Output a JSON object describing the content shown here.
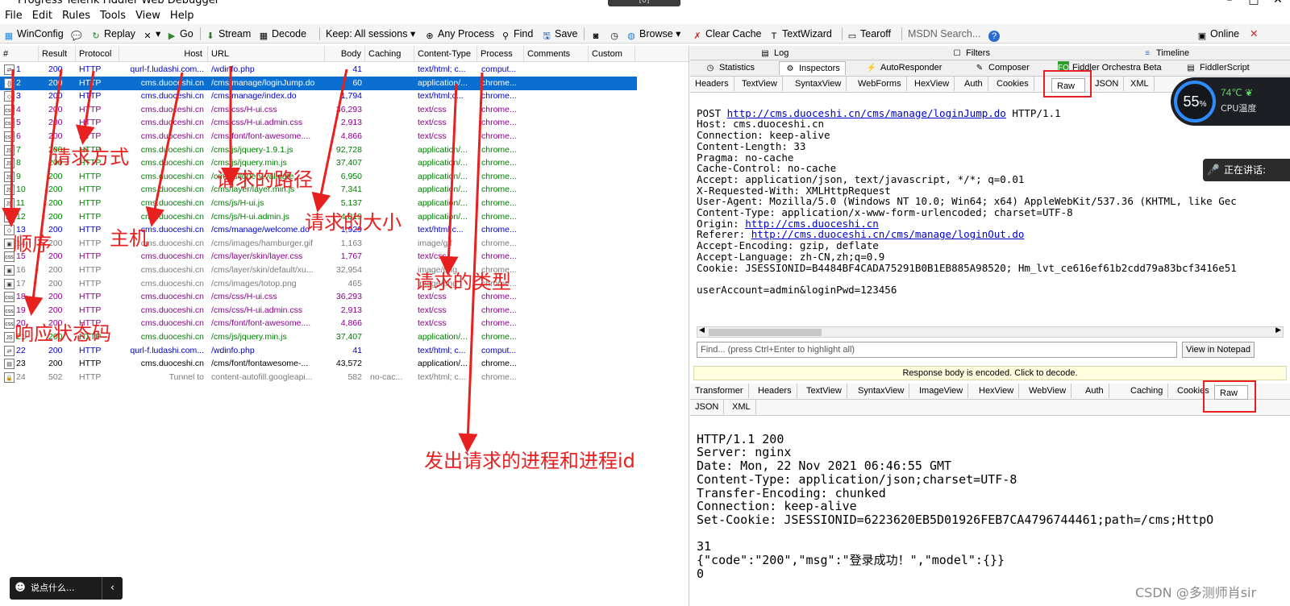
{
  "window": {
    "title": "Progress Telerik Fiddler Web Debugger",
    "controls": [
      "–",
      "□",
      "✕"
    ],
    "notice": "[0]"
  },
  "menu": [
    "File",
    "Edit",
    "Rules",
    "Tools",
    "View",
    "Help"
  ],
  "toolbar": {
    "winconfig": "WinConfig",
    "replay": "Replay",
    "remove_arrow": "▾",
    "go": "Go",
    "stream": "Stream",
    "decode": "Decode",
    "keep": "Keep: All sessions",
    "any_process": "Any Process",
    "find": "Find",
    "save": "Save",
    "browse": "Browse",
    "clear_cache": "Clear Cache",
    "textwizard": "TextWizard",
    "tearoff": "Tearoff",
    "msdn_search": "MSDN Search...",
    "online": "Online",
    "close_x": "✕"
  },
  "sessions": {
    "columns": [
      "#",
      "Result",
      "Protocol",
      "Host",
      "URL",
      "Body",
      "Caching",
      "Content-Type",
      "Process",
      "Comments",
      "Custom"
    ],
    "rows": [
      {
        "num": "1",
        "result": "200",
        "protocol": "HTTP",
        "host": "qurl-f.ludashi.com...",
        "url": "/wdinfo.php",
        "body": "41",
        "caching": "",
        "ctype": "text/html; c...",
        "process": "comput...",
        "icon": "⇄",
        "color": "#0000cc"
      },
      {
        "num": "2",
        "result": "200",
        "protocol": "HTTP",
        "host": "cms.duoceshi.cn",
        "url": "/cms/manage/loginJump.do",
        "body": "60",
        "caching": "",
        "ctype": "application/...",
        "process": "chrome...",
        "icon": "{}",
        "color": "#000000",
        "selected": true
      },
      {
        "num": "3",
        "result": "200",
        "protocol": "HTTP",
        "host": "cms.duoceshi.cn",
        "url": "/cms/manage/index.do",
        "body": "1,794",
        "caching": "",
        "ctype": "text/html;c...",
        "process": "chrome...",
        "icon": "◇",
        "color": "#0000cc"
      },
      {
        "num": "4",
        "result": "200",
        "protocol": "HTTP",
        "host": "cms.duoceshi.cn",
        "url": "/cms/css/H-ui.css",
        "body": "36,293",
        "caching": "",
        "ctype": "text/css",
        "process": "chrome...",
        "icon": "css",
        "color": "#8b008b"
      },
      {
        "num": "5",
        "result": "200",
        "protocol": "HTTP",
        "host": "cms.duoceshi.cn",
        "url": "/cms/css/H-ui.admin.css",
        "body": "2,913",
        "caching": "",
        "ctype": "text/css",
        "process": "chrome...",
        "icon": "css",
        "color": "#8b008b"
      },
      {
        "num": "6",
        "result": "200",
        "protocol": "HTTP",
        "host": "cms.duoceshi.cn",
        "url": "/cms/font/font-awesome....",
        "body": "4,866",
        "caching": "",
        "ctype": "text/css",
        "process": "chrome...",
        "icon": "css",
        "color": "#8b008b"
      },
      {
        "num": "7",
        "result": "200",
        "protocol": "HTTP",
        "host": "cms.duoceshi.cn",
        "url": "/cms/js/jquery-1.9.1.js",
        "body": "92,728",
        "caching": "",
        "ctype": "application/...",
        "process": "chrome...",
        "icon": "JS",
        "color": "#008000"
      },
      {
        "num": "8",
        "result": "200",
        "protocol": "HTTP",
        "host": "cms.duoceshi.cn",
        "url": "/cms/js/jquery.min.js",
        "body": "37,407",
        "caching": "",
        "ctype": "application/...",
        "process": "chrome...",
        "icon": "JS",
        "color": "#008000"
      },
      {
        "num": "9",
        "result": "200",
        "protocol": "HTTP",
        "host": "cms.duoceshi.cn",
        "url": "/cms/js/jquery.validate...",
        "body": "6,950",
        "caching": "",
        "ctype": "application/...",
        "process": "chrome...",
        "icon": "JS",
        "color": "#008000"
      },
      {
        "num": "10",
        "result": "200",
        "protocol": "HTTP",
        "host": "cms.duoceshi.cn",
        "url": "/cms/layer/layer.min.js",
        "body": "7,341",
        "caching": "",
        "ctype": "application/...",
        "process": "chrome...",
        "icon": "JS",
        "color": "#008000"
      },
      {
        "num": "11",
        "result": "200",
        "protocol": "HTTP",
        "host": "cms.duoceshi.cn",
        "url": "/cms/js/H-ui.js",
        "body": "5,137",
        "caching": "",
        "ctype": "application/...",
        "process": "chrome...",
        "icon": "JS",
        "color": "#008000"
      },
      {
        "num": "12",
        "result": "200",
        "protocol": "HTTP",
        "host": "cms.duoceshi.cn",
        "url": "/cms/js/H-ui.admin.js",
        "body": "4,819",
        "caching": "",
        "ctype": "application/...",
        "process": "chrome...",
        "icon": "JS",
        "color": "#008000"
      },
      {
        "num": "13",
        "result": "200",
        "protocol": "HTTP",
        "host": "cms.duoceshi.cn",
        "url": "/cms/manage/welcome.do",
        "body": "1,929",
        "caching": "",
        "ctype": "text/html;c...",
        "process": "chrome...",
        "icon": "◇",
        "color": "#0000cc"
      },
      {
        "num": "14",
        "result": "200",
        "protocol": "HTTP",
        "host": "cms.duoceshi.cn",
        "url": "/cms/images/hamburger.gif",
        "body": "1,163",
        "caching": "",
        "ctype": "image/gif",
        "process": "chrome...",
        "icon": "▣",
        "color": "#7a7a7a"
      },
      {
        "num": "15",
        "result": "200",
        "protocol": "HTTP",
        "host": "cms.duoceshi.cn",
        "url": "/cms/layer/skin/layer.css",
        "body": "1,767",
        "caching": "",
        "ctype": "text/css",
        "process": "chrome...",
        "icon": "css",
        "color": "#8b008b"
      },
      {
        "num": "16",
        "result": "200",
        "protocol": "HTTP",
        "host": "cms.duoceshi.cn",
        "url": "/cms/layer/skin/default/xu...",
        "body": "32,954",
        "caching": "",
        "ctype": "image/png",
        "process": "chrome...",
        "icon": "▣",
        "color": "#7a7a7a"
      },
      {
        "num": "17",
        "result": "200",
        "protocol": "HTTP",
        "host": "cms.duoceshi.cn",
        "url": "/cms/images/totop.png",
        "body": "465",
        "caching": "",
        "ctype": "image/png",
        "process": "chrome...",
        "icon": "▣",
        "color": "#7a7a7a"
      },
      {
        "num": "18",
        "result": "200",
        "protocol": "HTTP",
        "host": "cms.duoceshi.cn",
        "url": "/cms/css/H-ui.css",
        "body": "36,293",
        "caching": "",
        "ctype": "text/css",
        "process": "chrome...",
        "icon": "css",
        "color": "#8b008b"
      },
      {
        "num": "19",
        "result": "200",
        "protocol": "HTTP",
        "host": "cms.duoceshi.cn",
        "url": "/cms/css/H-ui.admin.css",
        "body": "2,913",
        "caching": "",
        "ctype": "text/css",
        "process": "chrome...",
        "icon": "css",
        "color": "#8b008b"
      },
      {
        "num": "20",
        "result": "200",
        "protocol": "HTTP",
        "host": "cms.duoceshi.cn",
        "url": "/cms/font/font-awesome....",
        "body": "4,866",
        "caching": "",
        "ctype": "text/css",
        "process": "chrome...",
        "icon": "css",
        "color": "#8b008b"
      },
      {
        "num": "21",
        "result": "200",
        "protocol": "HTTP",
        "host": "cms.duoceshi.cn",
        "url": "/cms/js/jquery.min.js",
        "body": "37,407",
        "caching": "",
        "ctype": "application/...",
        "process": "chrome...",
        "icon": "JS",
        "color": "#008000"
      },
      {
        "num": "22",
        "result": "200",
        "protocol": "HTTP",
        "host": "qurl-f.ludashi.com...",
        "url": "/wdinfo.php",
        "body": "41",
        "caching": "",
        "ctype": "text/html; c...",
        "process": "comput...",
        "icon": "⇄",
        "color": "#0000cc"
      },
      {
        "num": "23",
        "result": "200",
        "protocol": "HTTP",
        "host": "cms.duoceshi.cn",
        "url": "/cms/font/fontawesome-...",
        "body": "43,572",
        "caching": "",
        "ctype": "application/...",
        "process": "chrome...",
        "icon": "▤",
        "color": "#000000"
      },
      {
        "num": "24",
        "result": "502",
        "protocol": "HTTP",
        "host": "Tunnel to",
        "url": "content-autofill.googleapi...",
        "body": "582",
        "caching": "no-cac...",
        "ctype": "text/html; c...",
        "process": "chrome...",
        "icon": "🔒",
        "color": "#7a7a7a"
      }
    ]
  },
  "annotations": {
    "method": "请求方式",
    "path": "请求的路径",
    "size": "请求的大小",
    "order": "顺序",
    "host": "主机",
    "type": "请求的类型",
    "status": "响应状态码",
    "process": "发出请求的进程和进程id"
  },
  "right": {
    "top_tabs": [
      "Log",
      "Filters",
      "Timeline"
    ],
    "main_tabs": [
      "Statistics",
      "Inspectors",
      "AutoResponder",
      "Composer",
      "Fiddler Orchestra Beta",
      "FiddlerScript"
    ],
    "req_tabs": [
      "Headers",
      "TextView",
      "SyntaxView",
      "WebForms",
      "HexView",
      "Auth",
      "Cookies",
      "Raw",
      "JSON",
      "XML"
    ],
    "request": {
      "l1a": "POST ",
      "l1link": "http://cms.duoceshi.cn/cms/manage/loginJump.do",
      "l1b": " HTTP/1.1",
      "l2": "Host: cms.duoceshi.cn",
      "l3": "Connection: keep-alive",
      "l4": "Content-Length: 33",
      "l5": "Pragma: no-cache",
      "l6": "Cache-Control: no-cache",
      "l7": "Accept: application/json, text/javascript, */*; q=0.01",
      "l8": "X-Requested-With: XMLHttpRequest",
      "l9": "User-Agent: Mozilla/5.0 (Windows NT 10.0; Win64; x64) AppleWebKit/537.36 (KHTML, like Gec",
      "l10": "Content-Type: application/x-www-form-urlencoded; charset=UTF-8",
      "l11a": "Origin: ",
      "l11link": "http://cms.duoceshi.cn",
      "l12a": "Referer: ",
      "l12link": "http://cms.duoceshi.cn/cms/manage/loginOut.do",
      "l13": "Accept-Encoding: gzip, deflate",
      "l14": "Accept-Language: zh-CN,zh;q=0.9",
      "l15": "Cookie: JSESSIONID=B4484BF4CADA75291B0B1EB885A98520; Hm_lvt_ce616ef61b2cdd79a83bcf3416e51",
      "l16": "",
      "l17": "userAccount=admin&loginPwd=123456"
    },
    "find_placeholder": "Find... (press Ctrl+Enter to highlight all)",
    "view_notepad": "View in Notepad",
    "encoded_msg": "Response body is encoded. Click to decode.",
    "resp_tabs": [
      "Transformer",
      "Headers",
      "TextView",
      "SyntaxView",
      "ImageView",
      "HexView",
      "WebView",
      "Auth",
      "Caching",
      "Cookies",
      "Raw",
      "JSON",
      "XML"
    ],
    "response": {
      "r1": "HTTP/1.1 200",
      "r2": "Server: nginx",
      "r3": "Date: Mon, 22 Nov 2021 06:46:55 GMT",
      "r4": "Content-Type: application/json;charset=UTF-8",
      "r5": "Transfer-Encoding: chunked",
      "r6": "Connection: keep-alive",
      "r7": "Set-Cookie: JSESSIONID=6223620EB5D01926FEB7CA4796744461;path=/cms;HttpO",
      "r8": "",
      "r9": "31",
      "r10": "{\"code\":\"200\",\"msg\":\"登录成功！\",\"model\":{}}",
      "r11": "0"
    }
  },
  "overlays": {
    "cpu_percent": "55",
    "cpu_unit": "%",
    "cpu_temp": "74℃",
    "cpu_label": "CPU温度",
    "speaking": "正在讲话:",
    "say_something": "说点什么...",
    "watermark": "CSDN @多测师肖sir"
  }
}
